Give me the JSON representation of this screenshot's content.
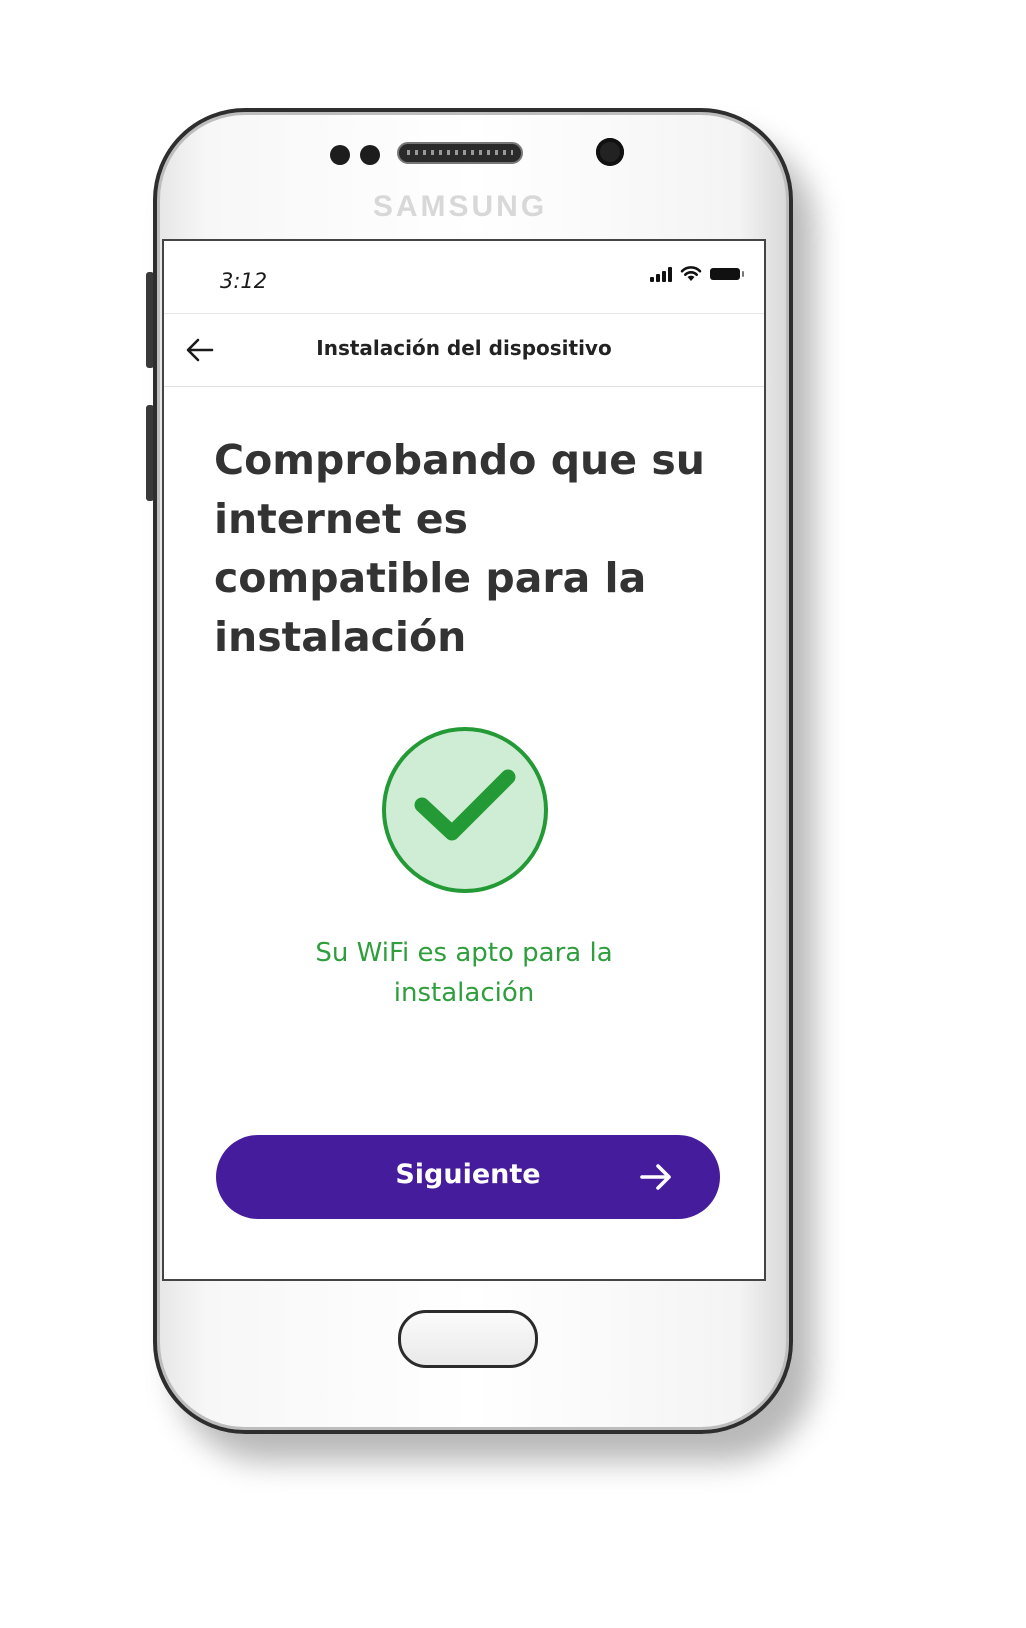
{
  "device": {
    "brand": "SAMSUNG"
  },
  "status_bar": {
    "time": "3:12",
    "icons": [
      "signal-icon",
      "wifi-icon",
      "battery-icon"
    ]
  },
  "header": {
    "title": "Instalación del dispositivo",
    "back_icon": "arrow-left-icon"
  },
  "main": {
    "title": "Comprobando que su internet es compatible para la instalación",
    "status_icon": "check-icon",
    "status_message": "Su WiFi es apto para la instalación"
  },
  "actions": {
    "next_label": "Siguiente",
    "next_icon": "arrow-right-icon"
  },
  "colors": {
    "primary": "#451c9c",
    "success": "#2f9e3d",
    "success_fill": "#cfedd4",
    "title_text": "#333333"
  }
}
